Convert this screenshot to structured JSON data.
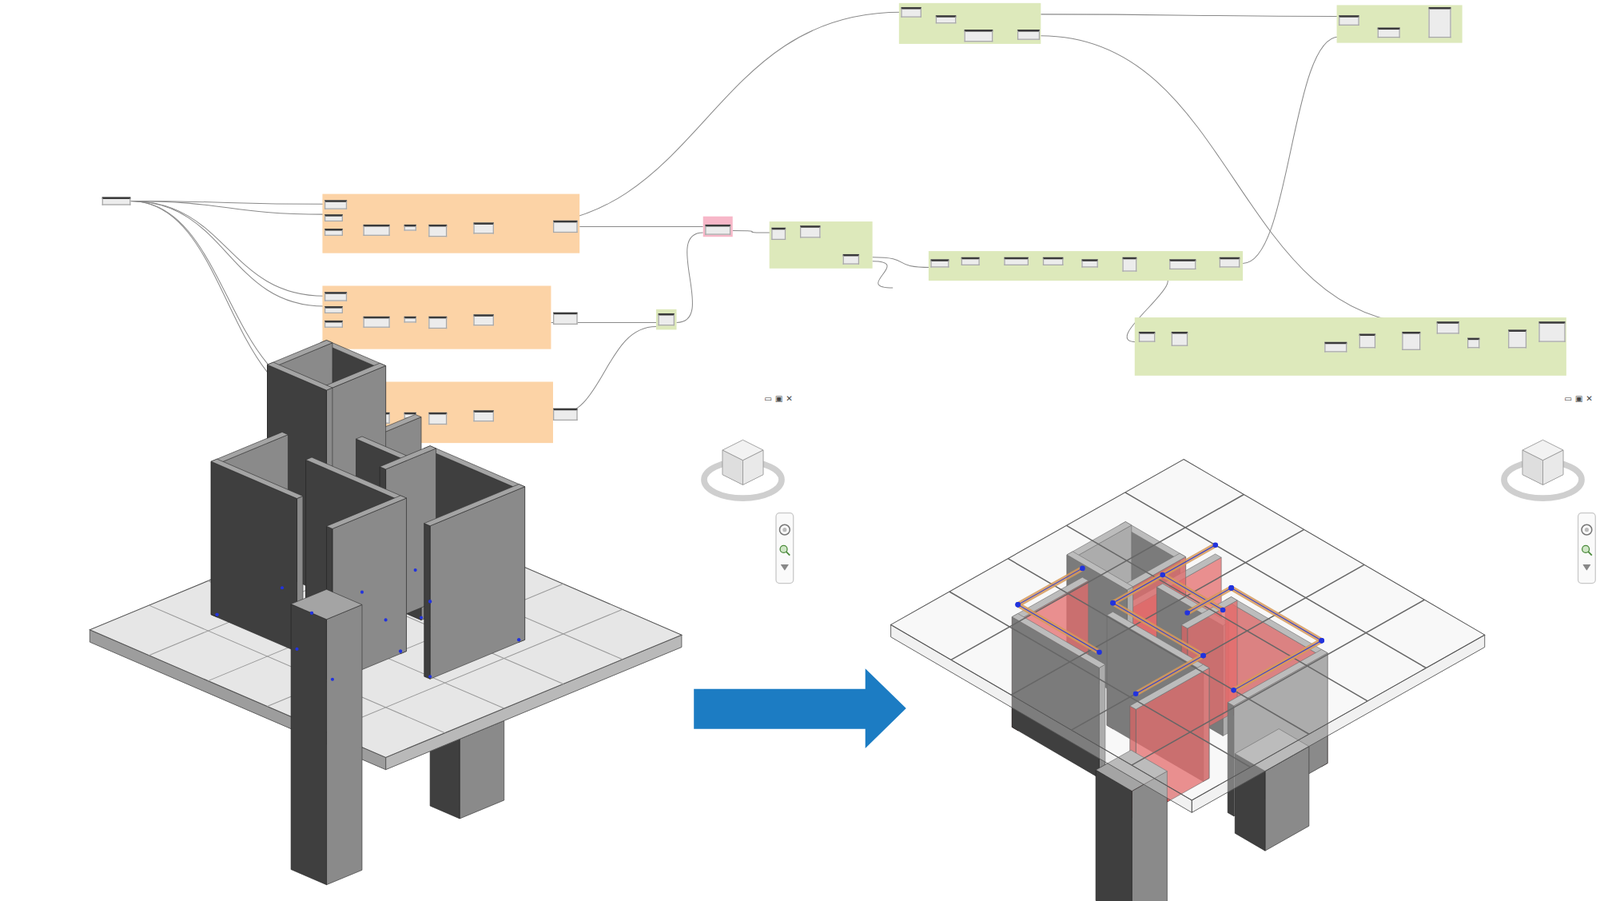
{
  "graph": {
    "groups": [
      {
        "color": "#fcd3a6"
      },
      {
        "color": "#fcd3a6"
      },
      {
        "color": "#fcd3a6"
      },
      {
        "color": "#dde9bb"
      },
      {
        "color": "#f7b7c8"
      },
      {
        "color": "#dde9bb"
      },
      {
        "color": "#dde9bb"
      },
      {
        "color": "#dde9bb"
      },
      {
        "color": "#dde9bb"
      },
      {
        "color": "#dde9bb"
      }
    ]
  },
  "views": [
    {
      "kind": "shaded",
      "controls": [
        "▭",
        "▣",
        "✕"
      ]
    },
    {
      "kind": "analytical",
      "controls": [
        "▭",
        "▣",
        "✕"
      ]
    }
  ]
}
